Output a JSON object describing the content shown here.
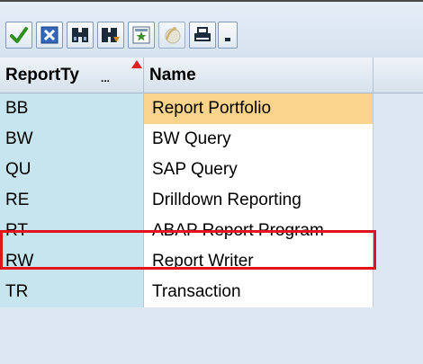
{
  "toolbar": {
    "buttons": [
      {
        "icon": "checkmark-icon",
        "color": "#2f8f1f"
      },
      {
        "icon": "cancel-icon",
        "color": "#2f5fb0"
      },
      {
        "icon": "find-icon",
        "color": "#1c2b3b"
      },
      {
        "icon": "find-next-icon",
        "color": "#1c2b3b"
      },
      {
        "icon": "filter-icon",
        "color": "#3a8f2a"
      },
      {
        "icon": "help-icon",
        "color": "#c8a040"
      },
      {
        "icon": "print-icon",
        "color": "#1c2b3b"
      },
      {
        "icon": "dropdown-icon",
        "color": "#1c2b3b"
      }
    ]
  },
  "table": {
    "columns": [
      {
        "label": "ReportTy",
        "ellipsis": "...",
        "sorted": "ascending"
      },
      {
        "label": "Name"
      }
    ],
    "rows": [
      {
        "type": "BB",
        "name": "Report Portfolio",
        "selected": true
      },
      {
        "type": "BW",
        "name": "BW Query"
      },
      {
        "type": "QU",
        "name": "SAP Query"
      },
      {
        "type": "RE",
        "name": "Drilldown Reporting"
      },
      {
        "type": "RT",
        "name": "ABAP Report Program",
        "highlighted": true
      },
      {
        "type": "RW",
        "name": "Report Writer"
      },
      {
        "type": "TR",
        "name": "Transaction"
      }
    ]
  },
  "colors": {
    "selected_row": "#fad48a",
    "key_column": "#c7e5ee",
    "highlight_border": "#e2131d"
  }
}
